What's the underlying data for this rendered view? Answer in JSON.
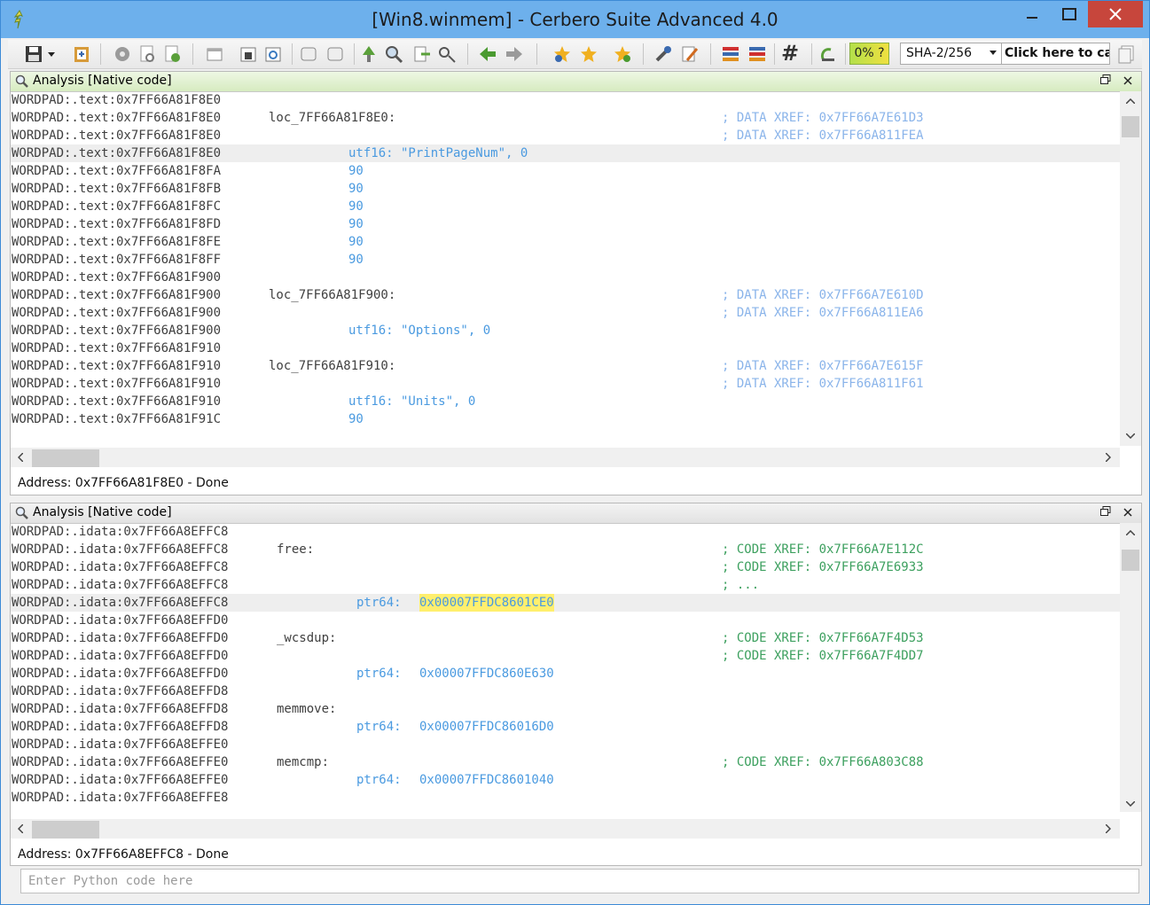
{
  "window": {
    "title": "[Win8.winmem] - Cerbero Suite Advanced 4.0",
    "minimize_icon": "minimize-icon",
    "maximize_icon": "maximize-icon",
    "close_icon": "close-icon"
  },
  "toolbar": {
    "percent_label": "0% ?",
    "hash_select": "SHA-2/256",
    "hash_button": "Click here to cal",
    "hash_symbol": "#"
  },
  "top_pane": {
    "title": "Analysis [Native code]",
    "status": "Address: 0x7FF66A81F8E0 - Done",
    "lines": [
      {
        "addr": "WORDPAD:.text:0x7FF66A81F8E0",
        "label": "",
        "instr": "",
        "comment": ""
      },
      {
        "addr": "WORDPAD:.text:0x7FF66A81F8E0",
        "label": "loc_7FF66A81F8E0:",
        "instr": "",
        "comment": "; DATA XREF: 0x7FF66A7E61D3"
      },
      {
        "addr": "WORDPAD:.text:0x7FF66A81F8E0",
        "label": "",
        "instr": "",
        "comment": "; DATA XREF: 0x7FF66A811FEA"
      },
      {
        "addr": "WORDPAD:.text:0x7FF66A81F8E0",
        "label": "",
        "instr": "utf16: \"PrintPageNum\", 0",
        "comment": ""
      },
      {
        "addr": "WORDPAD:.text:0x7FF66A81F8FA",
        "label": "",
        "instr": "90",
        "comment": ""
      },
      {
        "addr": "WORDPAD:.text:0x7FF66A81F8FB",
        "label": "",
        "instr": "90",
        "comment": ""
      },
      {
        "addr": "WORDPAD:.text:0x7FF66A81F8FC",
        "label": "",
        "instr": "90",
        "comment": ""
      },
      {
        "addr": "WORDPAD:.text:0x7FF66A81F8FD",
        "label": "",
        "instr": "90",
        "comment": ""
      },
      {
        "addr": "WORDPAD:.text:0x7FF66A81F8FE",
        "label": "",
        "instr": "90",
        "comment": ""
      },
      {
        "addr": "WORDPAD:.text:0x7FF66A81F8FF",
        "label": "",
        "instr": "90",
        "comment": ""
      },
      {
        "addr": "WORDPAD:.text:0x7FF66A81F900",
        "label": "",
        "instr": "",
        "comment": ""
      },
      {
        "addr": "WORDPAD:.text:0x7FF66A81F900",
        "label": "loc_7FF66A81F900:",
        "instr": "",
        "comment": "; DATA XREF: 0x7FF66A7E610D"
      },
      {
        "addr": "WORDPAD:.text:0x7FF66A81F900",
        "label": "",
        "instr": "",
        "comment": "; DATA XREF: 0x7FF66A811EA6"
      },
      {
        "addr": "WORDPAD:.text:0x7FF66A81F900",
        "label": "",
        "instr": "utf16: \"Options\", 0",
        "comment": ""
      },
      {
        "addr": "WORDPAD:.text:0x7FF66A81F910",
        "label": "",
        "instr": "",
        "comment": ""
      },
      {
        "addr": "WORDPAD:.text:0x7FF66A81F910",
        "label": "loc_7FF66A81F910:",
        "instr": "",
        "comment": "; DATA XREF: 0x7FF66A7E615F"
      },
      {
        "addr": "WORDPAD:.text:0x7FF66A81F910",
        "label": "",
        "instr": "",
        "comment": "; DATA XREF: 0x7FF66A811F61"
      },
      {
        "addr": "WORDPAD:.text:0x7FF66A81F910",
        "label": "",
        "instr": "utf16: \"Units\", 0",
        "comment": ""
      },
      {
        "addr": "WORDPAD:.text:0x7FF66A81F91C",
        "label": "",
        "instr": "90",
        "comment": ""
      }
    ]
  },
  "bottom_pane": {
    "title": "Analysis [Native code]",
    "status": "Address: 0x7FF66A8EFFC8 - Done",
    "lines": [
      {
        "addr": "WORDPAD:.idata:0x7FF66A8EFFC8",
        "label": "",
        "instr": "",
        "value": "",
        "comment": ""
      },
      {
        "addr": "WORDPAD:.idata:0x7FF66A8EFFC8",
        "label": "free:",
        "instr": "",
        "value": "",
        "comment": "; CODE XREF: 0x7FF66A7E112C"
      },
      {
        "addr": "WORDPAD:.idata:0x7FF66A8EFFC8",
        "label": "",
        "instr": "",
        "value": "",
        "comment": "; CODE XREF: 0x7FF66A7E6933"
      },
      {
        "addr": "WORDPAD:.idata:0x7FF66A8EFFC8",
        "label": "",
        "instr": "",
        "value": "",
        "comment": "; ..."
      },
      {
        "addr": "WORDPAD:.idata:0x7FF66A8EFFC8",
        "label": "",
        "instr": "ptr64:",
        "value": "0x00007FFDC8601CE0",
        "comment": ""
      },
      {
        "addr": "WORDPAD:.idata:0x7FF66A8EFFD0",
        "label": "",
        "instr": "",
        "value": "",
        "comment": ""
      },
      {
        "addr": "WORDPAD:.idata:0x7FF66A8EFFD0",
        "label": "_wcsdup:",
        "instr": "",
        "value": "",
        "comment": "; CODE XREF: 0x7FF66A7F4D53"
      },
      {
        "addr": "WORDPAD:.idata:0x7FF66A8EFFD0",
        "label": "",
        "instr": "",
        "value": "",
        "comment": "; CODE XREF: 0x7FF66A7F4DD7"
      },
      {
        "addr": "WORDPAD:.idata:0x7FF66A8EFFD0",
        "label": "",
        "instr": "ptr64:",
        "value": "0x00007FFDC860E630",
        "comment": ""
      },
      {
        "addr": "WORDPAD:.idata:0x7FF66A8EFFD8",
        "label": "",
        "instr": "",
        "value": "",
        "comment": ""
      },
      {
        "addr": "WORDPAD:.idata:0x7FF66A8EFFD8",
        "label": "memmove:",
        "instr": "",
        "value": "",
        "comment": ""
      },
      {
        "addr": "WORDPAD:.idata:0x7FF66A8EFFD8",
        "label": "",
        "instr": "ptr64:",
        "value": "0x00007FFDC86016D0",
        "comment": ""
      },
      {
        "addr": "WORDPAD:.idata:0x7FF66A8EFFE0",
        "label": "",
        "instr": "",
        "value": "",
        "comment": ""
      },
      {
        "addr": "WORDPAD:.idata:0x7FF66A8EFFE0",
        "label": "memcmp:",
        "instr": "",
        "value": "",
        "comment": "; CODE XREF: 0x7FF66A803C88"
      },
      {
        "addr": "WORDPAD:.idata:0x7FF66A8EFFE0",
        "label": "",
        "instr": "ptr64:",
        "value": "0x00007FFDC8601040",
        "comment": ""
      },
      {
        "addr": "WORDPAD:.idata:0x7FF66A8EFFE8",
        "label": "",
        "instr": "",
        "value": "",
        "comment": ""
      }
    ]
  },
  "python_input": {
    "placeholder": "Enter Python code here"
  },
  "colors": {
    "titlebar": "#6db0ec",
    "instr": "#4a9ae0",
    "data_xref": "#8ab4ea",
    "code_xref": "#3da05f",
    "selection": "#ffef6e"
  }
}
